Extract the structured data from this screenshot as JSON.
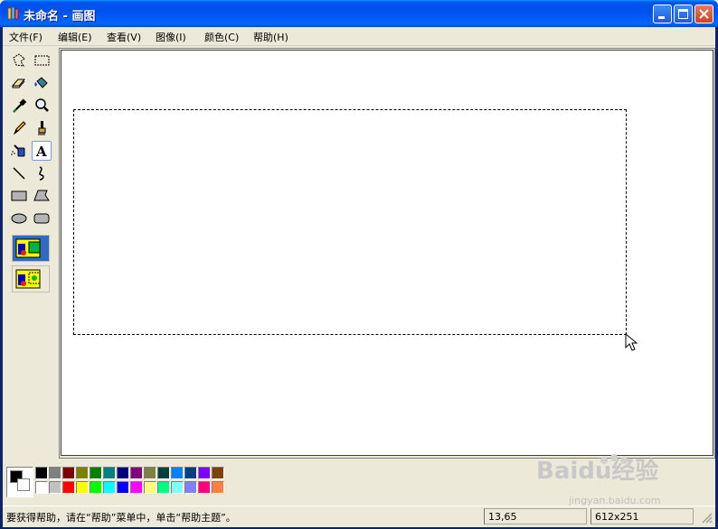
{
  "window": {
    "title": "未命名 - 画图"
  },
  "menu": [
    {
      "label": "文件(F)"
    },
    {
      "label": "编辑(E)"
    },
    {
      "label": "查看(V)"
    },
    {
      "label": "图像(I)"
    },
    {
      "label": "颜色(C)"
    },
    {
      "label": "帮助(H)"
    }
  ],
  "tools": [
    "free-form-select-icon",
    "rect-select-icon",
    "eraser-icon",
    "fill-icon",
    "pick-color-icon",
    "magnifier-icon",
    "pencil-icon",
    "brush-icon",
    "airbrush-icon",
    "text-icon",
    "line-icon",
    "curve-icon",
    "rectangle-icon",
    "polygon-icon",
    "ellipse-icon",
    "rounded-rect-icon"
  ],
  "selected_tool": "text-icon",
  "text_tool_label": "A",
  "palette": {
    "top": [
      "#000000",
      "#808080",
      "#800000",
      "#808000",
      "#008000",
      "#008080",
      "#000080",
      "#800080",
      "#808040",
      "#004040",
      "#0080FF",
      "#004080",
      "#8000FF",
      "#804000"
    ],
    "bottom": [
      "#FFFFFF",
      "#C0C0C0",
      "#FF0000",
      "#FFFF00",
      "#00FF00",
      "#00FFFF",
      "#0000FF",
      "#FF00FF",
      "#FFFF80",
      "#00FF80",
      "#80FFFF",
      "#8080FF",
      "#FF0080",
      "#FF8040"
    ],
    "foreground": "#000000",
    "background": "#FFFFFF"
  },
  "status": {
    "help_text": "要获得帮助，请在“帮助”菜单中，单击“帮助主题”。",
    "cursor_pos": "13,65",
    "selection_size": "612x251"
  },
  "watermark": {
    "logo": "Baidu经验",
    "url": "jingyan.baidu.com"
  }
}
